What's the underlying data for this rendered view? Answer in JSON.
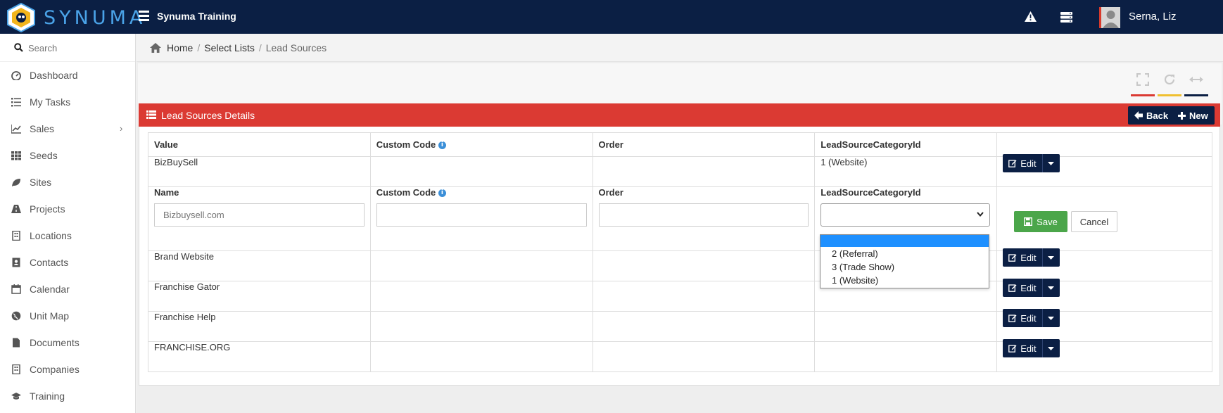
{
  "header": {
    "logo_text": "SYNUMA",
    "app_title": "Synuma Training",
    "user_name": "Serna, Liz"
  },
  "sidebar": {
    "search_placeholder": "Search",
    "items": [
      {
        "label": "Dashboard",
        "icon": "dashboard-icon"
      },
      {
        "label": "My Tasks",
        "icon": "list-icon"
      },
      {
        "label": "Sales",
        "icon": "line-chart-icon",
        "has_children": true
      },
      {
        "label": "Seeds",
        "icon": "grid-icon"
      },
      {
        "label": "Sites",
        "icon": "leaf-icon"
      },
      {
        "label": "Projects",
        "icon": "road-icon"
      },
      {
        "label": "Locations",
        "icon": "building-icon"
      },
      {
        "label": "Contacts",
        "icon": "address-book-icon"
      },
      {
        "label": "Calendar",
        "icon": "calendar-icon"
      },
      {
        "label": "Unit Map",
        "icon": "globe-icon"
      },
      {
        "label": "Documents",
        "icon": "file-icon"
      },
      {
        "label": "Companies",
        "icon": "building-icon"
      },
      {
        "label": "Training",
        "icon": "graduation-cap-icon"
      }
    ]
  },
  "breadcrumb": {
    "home": "Home",
    "select_lists": "Select Lists",
    "current": "Lead Sources"
  },
  "widget": {
    "title": "Lead Sources Details",
    "back_label": "Back",
    "new_label": "New",
    "toolbar_colors": [
      "#db3a33",
      "#f0c030",
      "#0b1f44"
    ]
  },
  "table": {
    "columns": [
      "Value",
      "Custom Code",
      "Order",
      "LeadSourceCategoryId"
    ],
    "rows": [
      {
        "value": "BizBuySell",
        "custom_code": "",
        "order": "",
        "category": "1 (Website)"
      },
      {
        "value": "Brand Website",
        "custom_code": "",
        "order": "",
        "category": ""
      },
      {
        "value": "Franchise Gator",
        "custom_code": "",
        "order": "",
        "category": ""
      },
      {
        "value": "Franchise Help",
        "custom_code": "",
        "order": "",
        "category": ""
      },
      {
        "value": "FRANCHISE.ORG",
        "custom_code": "",
        "order": "",
        "category": ""
      }
    ],
    "edit_label": "Edit"
  },
  "edit_form": {
    "name_label": "Name",
    "custom_code_label": "Custom Code",
    "order_label": "Order",
    "category_label": "LeadSourceCategoryId",
    "name_placeholder": "Bizbuysell.com",
    "save_label": "Save",
    "cancel_label": "Cancel",
    "category_options": [
      "",
      "2 (Referral)",
      "3 (Trade Show)",
      "1 (Website)"
    ],
    "category_selected": ""
  },
  "colors": {
    "navy": "#0b1f44",
    "red": "#db3a33",
    "green": "#4ba64a",
    "info_blue": "#3b8fd8",
    "select_highlight": "#1e90ff"
  }
}
